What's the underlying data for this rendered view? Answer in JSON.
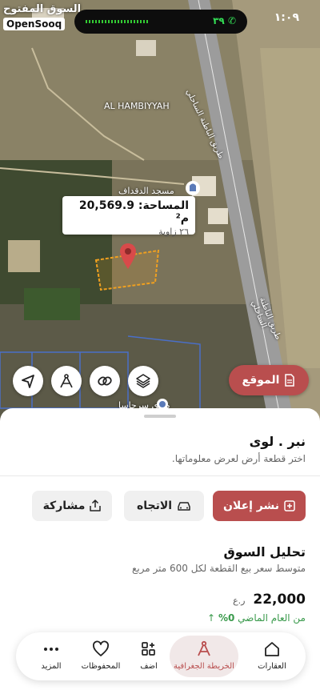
{
  "status_bar": {
    "time": "١:٠٩",
    "call_timer": "٣٩"
  },
  "watermark": {
    "arabic": "السوق المفتوح",
    "english": "OpenSooq"
  },
  "map": {
    "area_label": "المساحة: 20,569.9 م²",
    "angles_label": "٢٦ زاوية",
    "place_name": "AL HAMBIYYAH",
    "mosque_label": "مسجد الدقداف",
    "road_label": "طريق الباطنة الساحلي",
    "road_label_2": "طريق الباطنة الساحلي",
    "bottom_place": "طوي سرحاسا",
    "location_button": "الموقع"
  },
  "sheet": {
    "title": "نبر . لوى",
    "subtitle": "اختر قطعة أرض لعرض معلوماتها.",
    "buttons": {
      "post": "نشر إعلان",
      "directions": "الاتجاه",
      "share": "مشاركة"
    },
    "market": {
      "title": "تحليل السوق",
      "subtitle": "متوسط سعر بيع القطعة لكل 600 متر مربع",
      "price": "22,000",
      "currency": "ر.ع",
      "change_label": "من العام الماضي",
      "change_value": "0%"
    }
  },
  "tabs": [
    {
      "label": "العقارات",
      "icon": "home-icon"
    },
    {
      "label": "الخريطة الجغرافية",
      "icon": "map-compass-icon"
    },
    {
      "label": "اضف",
      "icon": "add-grid-icon"
    },
    {
      "label": "المحفوظات",
      "icon": "heart-icon"
    },
    {
      "label": "المزيد",
      "icon": "more-icon"
    }
  ],
  "colors": {
    "accent": "#b94e4e",
    "positive": "#3a9a4c",
    "parcel_outline": "#f0a020"
  }
}
